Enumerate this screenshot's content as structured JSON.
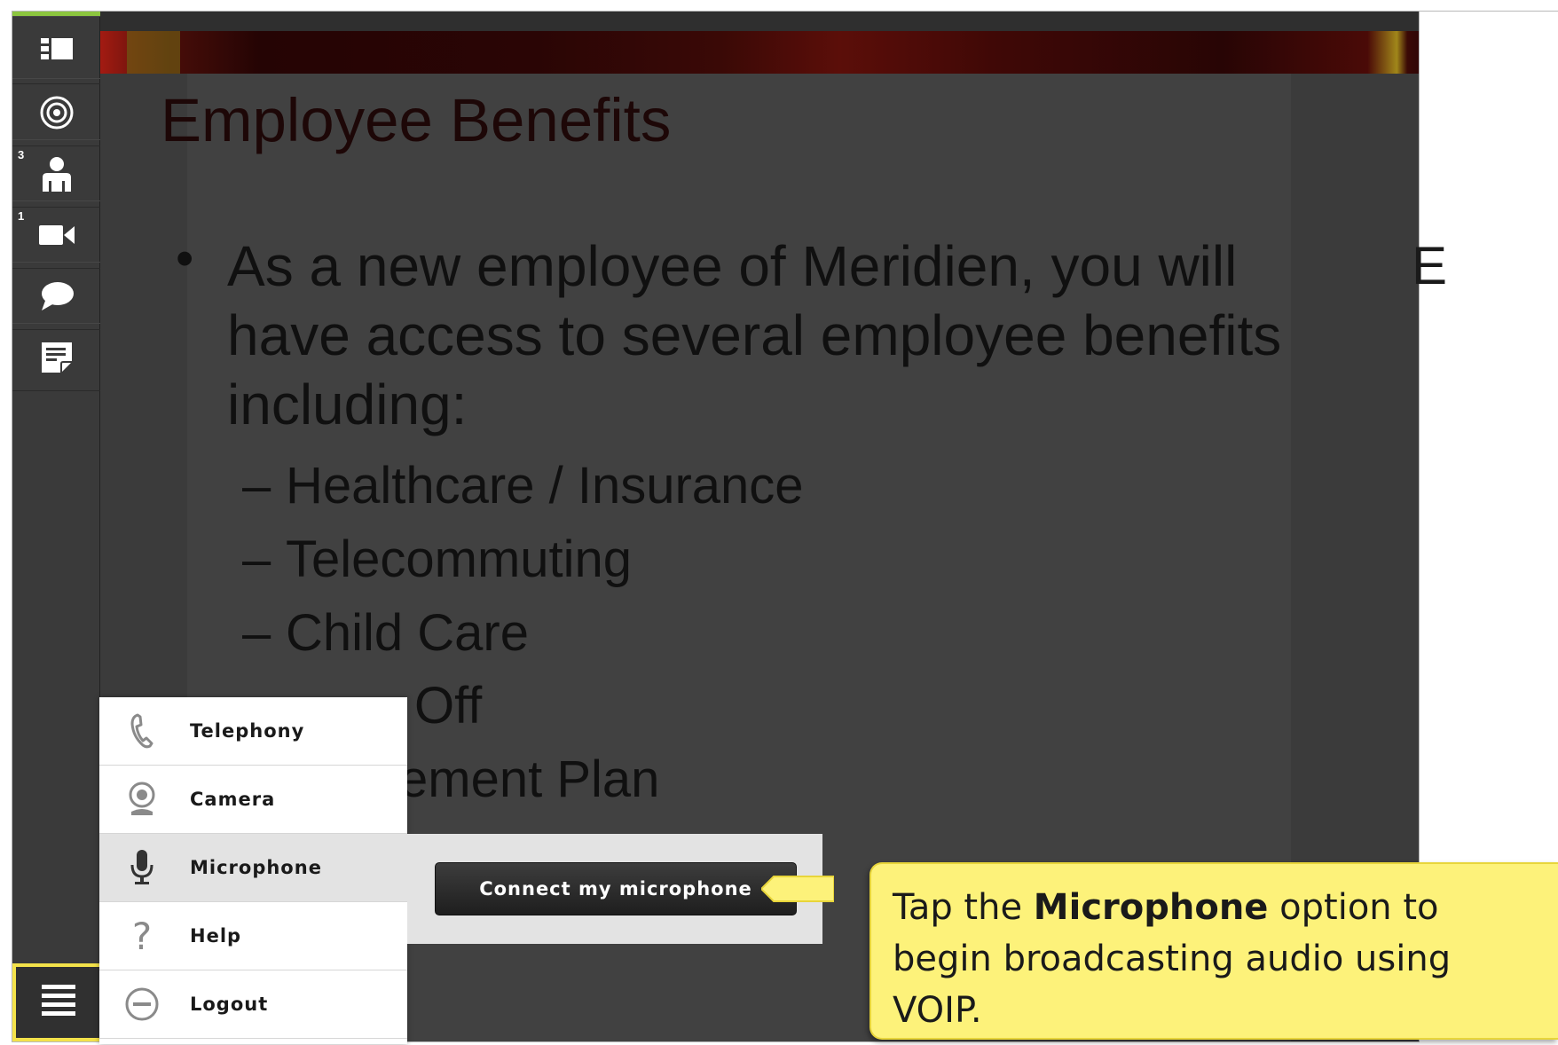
{
  "sidebar": {
    "buttons": [
      {
        "icon": "layout-icon",
        "badge": ""
      },
      {
        "icon": "target-icon",
        "badge": ""
      },
      {
        "icon": "attendees-icon",
        "badge": "3"
      },
      {
        "icon": "camera-icon",
        "badge": "1"
      },
      {
        "icon": "chat-icon",
        "badge": ""
      },
      {
        "icon": "notes-icon",
        "badge": ""
      }
    ],
    "menu_icon": "hamburger-menu-icon"
  },
  "slide": {
    "title": "Employee Benefits",
    "bullet": "As a new employee of Meridien, you will have access to several employee benefits including:",
    "sub_items": [
      "Healthcare / Insurance",
      "Telecommuting",
      "Child Care",
      "Time Off",
      "Retirement Plan"
    ],
    "visible_fragments": {
      "time_off": "Off",
      "retirement": "ement Plan"
    },
    "stray_glyph": "E"
  },
  "menu": {
    "items": [
      {
        "label": "Telephony",
        "icon": "phone-icon"
      },
      {
        "label": "Camera",
        "icon": "webcam-icon"
      },
      {
        "label": "Microphone",
        "icon": "microphone-icon"
      },
      {
        "label": "Help",
        "icon": "help-icon"
      },
      {
        "label": "Logout",
        "icon": "logout-icon"
      }
    ]
  },
  "connect": {
    "button_label": "Connect my microphone"
  },
  "callout": {
    "prefix": "Tap the ",
    "bold": "Microphone",
    "suffix": " option to begin broadcasting audio using VOIP."
  },
  "colors": {
    "accent_green": "#8cc63f",
    "highlight_yellow": "#f3e24a",
    "callout_bg": "#fdf27a"
  }
}
